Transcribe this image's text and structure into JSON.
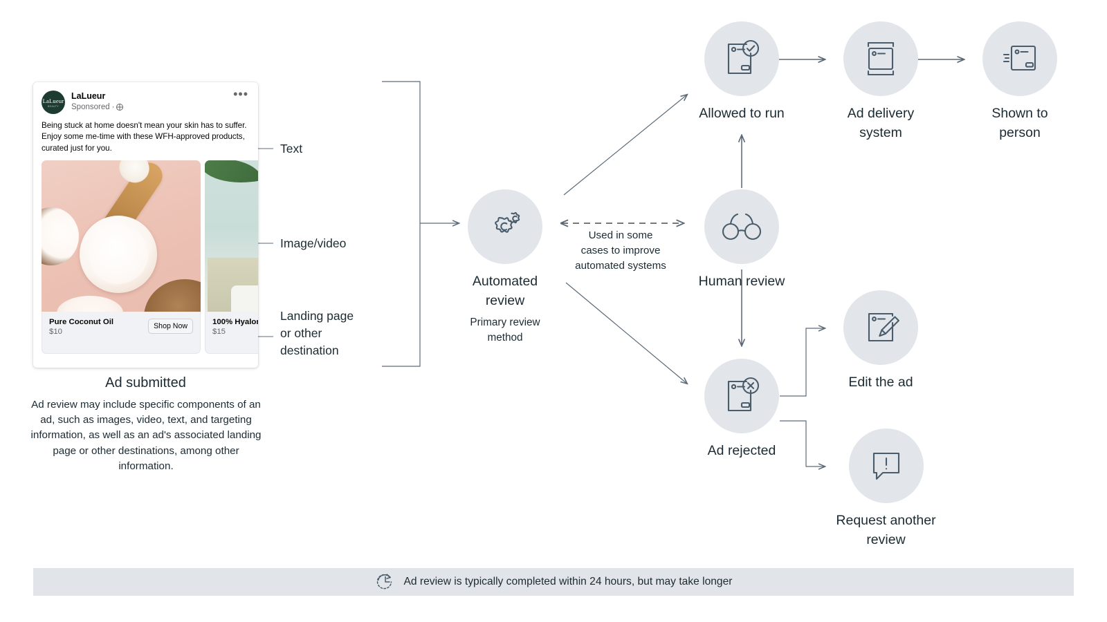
{
  "ad_card": {
    "page_name": "LaLueur",
    "avatar_text": "LaLueur",
    "avatar_subtext": "BEAUTY",
    "sponsored_label": "Sponsored",
    "separator": "·",
    "menu_icon": "•••",
    "body_text": "Being stuck at home doesn't mean your skin has to suffer. Enjoy some me-time with these WFH-approved products, curated just for you.",
    "products": [
      {
        "title": "Pure Coconut Oil",
        "price": "$10",
        "cta": "Shop Now"
      },
      {
        "title": "100% Hyalor",
        "price": "$15"
      }
    ]
  },
  "annotations": [
    {
      "id": "text",
      "label": "Text"
    },
    {
      "id": "image-video",
      "label": "Image/video"
    },
    {
      "id": "landing-page",
      "label": "Landing page\nor other\ndestination"
    }
  ],
  "caption": {
    "title": "Ad submitted",
    "body": "Ad review may include specific components of an ad, such as images, video, text, and targeting information, as well as an ad's associated landing page or other destinations, among other information."
  },
  "nodes": {
    "automated_review": {
      "label": "Automated\nreview",
      "sublabel": "Primary review\nmethod",
      "icon": "gears-icon"
    },
    "human_review": {
      "label": "Human review",
      "icon": "glasses-icon"
    },
    "allowed_to_run": {
      "label": "Allowed to run",
      "icon": "document-check-icon"
    },
    "ad_delivery_system": {
      "label": "Ad delivery\nsystem",
      "icon": "stacked-cards-icon"
    },
    "shown_to_person": {
      "label": "Shown to\nperson",
      "icon": "card-motion-icon"
    },
    "ad_rejected": {
      "label": "Ad rejected",
      "icon": "document-x-icon"
    },
    "edit_the_ad": {
      "label": "Edit the ad",
      "icon": "pencil-edit-icon"
    },
    "request_another_review": {
      "label": "Request another\nreview",
      "icon": "speech-bubble-alert-icon"
    }
  },
  "dashed_connector": {
    "label": "Used in some\ncases to improve\nautomated systems"
  },
  "footer": {
    "text": "Ad review is typically completed within 24 hours, but may take longer",
    "icon": "clock-refresh-icon"
  },
  "colors": {
    "node_circle": "#e2e6ea",
    "icon_stroke": "#4a5c6b",
    "line": "#5c6b7a",
    "footer_bg": "#e1e4e8",
    "text": "#1c2b33",
    "avatar_bg": "#1d3b31"
  }
}
